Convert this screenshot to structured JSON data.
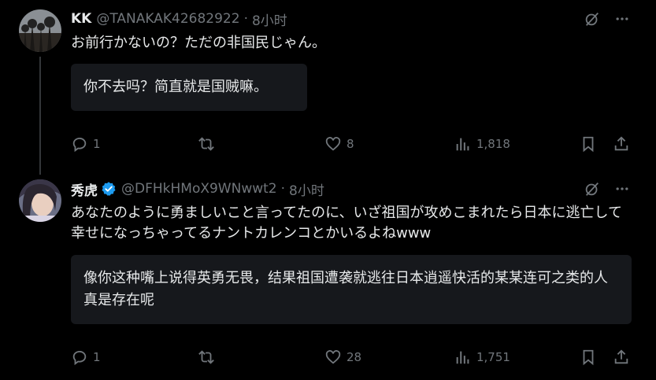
{
  "tweets": [
    {
      "display_name": "KK",
      "handle": "@TANAKAK42682922",
      "separator": "·",
      "time": "8小时",
      "text": "お前行かないの？ただの非国民じゃん。",
      "translation": "你不去吗？简直就是国贼嘛。",
      "replies": "1",
      "retweets": "",
      "likes": "8",
      "views": "1,818"
    },
    {
      "display_name": "秀虎",
      "verified": true,
      "handle": "@DFHkHMoX9WNwwt2",
      "separator": "·",
      "time": "8小时",
      "text": "あなたのように勇ましいこと言ってたのに、いざ祖国が攻めこまれたら日本に逃亡して幸せになっちゃってるナントカレンコとかいるよねwww",
      "translation": "像你这种嘴上说得英勇无畏，结果祖国遭袭就逃往日本逍遥快活的某某连可之类的人真是存在呢",
      "replies": "1",
      "retweets": "",
      "likes": "28",
      "views": "1,751"
    }
  ],
  "colors": {
    "background": "#000000",
    "text_primary": "#e7e9ea",
    "text_secondary": "#71767b",
    "translation_bg": "#16181c",
    "verified_blue": "#1d9bf0"
  },
  "icons": [
    "grok-icon",
    "more-icon",
    "reply-icon",
    "retweet-icon",
    "like-icon",
    "views-icon",
    "bookmark-icon",
    "share-icon",
    "verified-badge-icon"
  ]
}
